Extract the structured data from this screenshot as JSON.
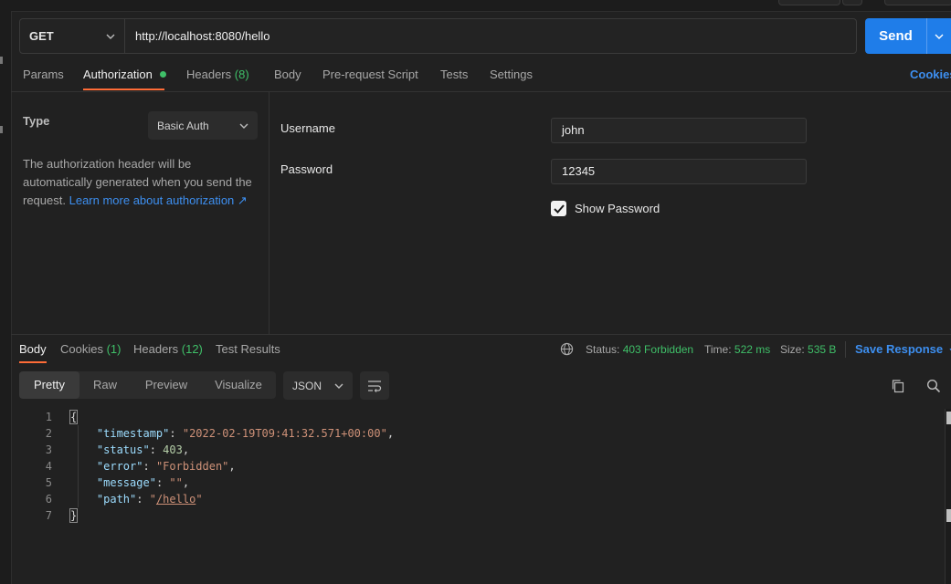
{
  "request": {
    "method": "GET",
    "url": "http://localhost:8080/hello",
    "send_label": "Send"
  },
  "request_tabs": [
    {
      "label": "Params"
    },
    {
      "label": "Authorization"
    },
    {
      "label": "Headers",
      "count": "(8)"
    },
    {
      "label": "Body"
    },
    {
      "label": "Pre-request Script"
    },
    {
      "label": "Tests"
    },
    {
      "label": "Settings"
    }
  ],
  "cookies_link": "Cookies",
  "auth": {
    "type_label": "Type",
    "type_value": "Basic Auth",
    "description": "The authorization header will be automatically generated when you send the request.",
    "learn_more": "Learn more about authorization ↗",
    "username_label": "Username",
    "username_value": "john",
    "password_label": "Password",
    "password_value": "12345",
    "show_password_label": "Show Password",
    "show_password_checked": true
  },
  "response_tabs": [
    {
      "label": "Body"
    },
    {
      "label": "Cookies",
      "count": "(1)"
    },
    {
      "label": "Headers",
      "count": "(12)"
    },
    {
      "label": "Test Results"
    }
  ],
  "response_meta": {
    "status_label": "Status:",
    "status_value": "403 Forbidden",
    "time_label": "Time:",
    "time_value": "522 ms",
    "size_label": "Size:",
    "size_value": "535 B",
    "save_response": "Save Response"
  },
  "view_modes": [
    "Pretty",
    "Raw",
    "Preview",
    "Visualize"
  ],
  "format": "JSON",
  "code_lines": [
    {
      "n": "1",
      "open": "{"
    },
    {
      "n": "2",
      "key": "\"timestamp\"",
      "value": "\"2022-02-19T09:41:32.571+00:00\"",
      "type": "str"
    },
    {
      "n": "3",
      "key": "\"status\"",
      "value": "403",
      "type": "num"
    },
    {
      "n": "4",
      "key": "\"error\"",
      "value": "\"Forbidden\"",
      "type": "str"
    },
    {
      "n": "5",
      "key": "\"message\"",
      "value": "\"\"",
      "type": "str"
    },
    {
      "n": "6",
      "key": "\"path\"",
      "value_q1": "\"",
      "value_link": "/hello",
      "value_q2": "\"",
      "type": "link"
    },
    {
      "n": "7",
      "close": "}"
    }
  ]
}
